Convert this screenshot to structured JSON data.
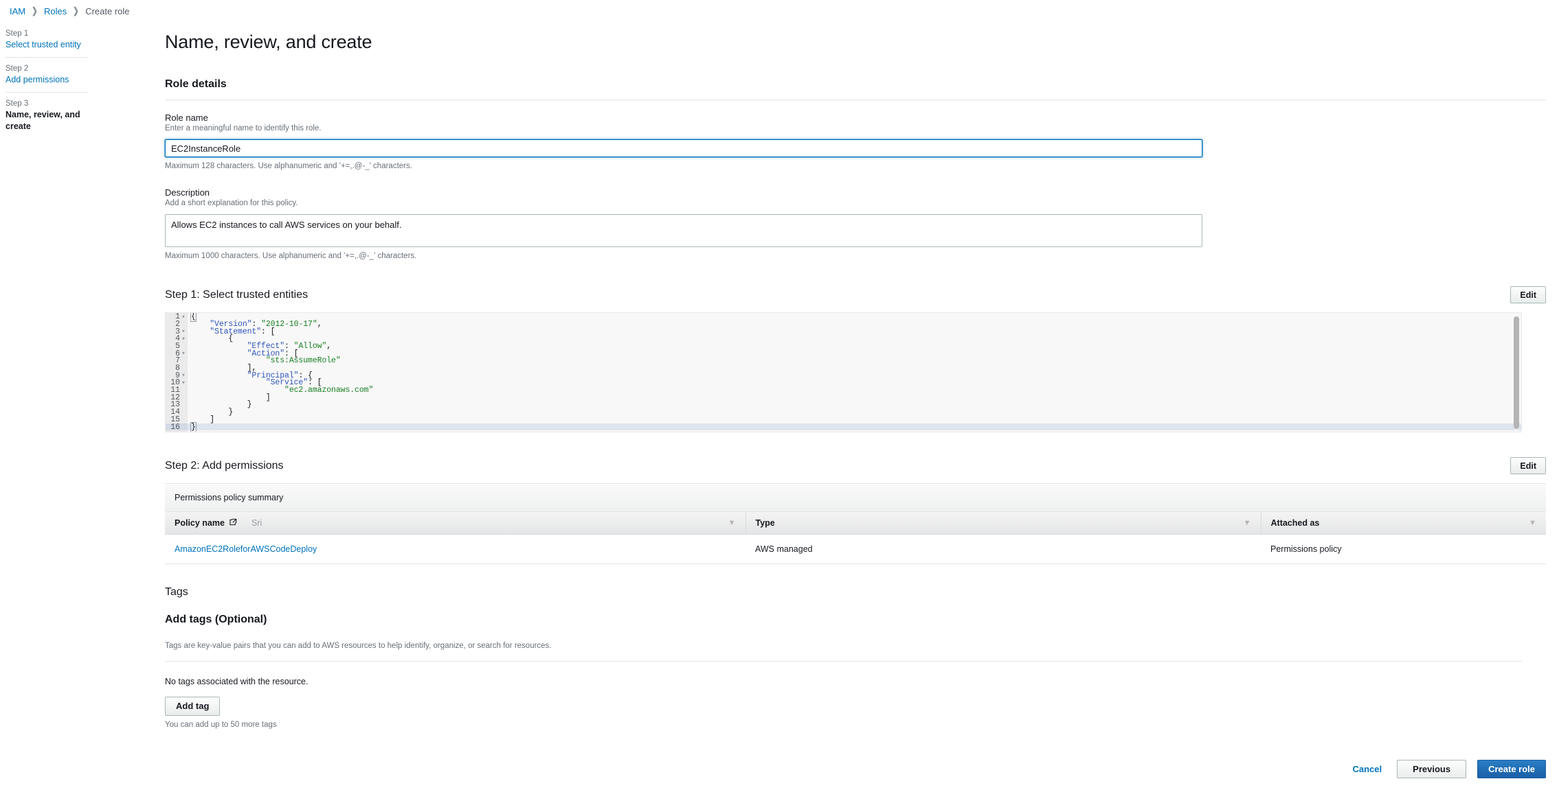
{
  "breadcrumb": {
    "items": [
      {
        "label": "IAM",
        "type": "link"
      },
      {
        "label": "Roles",
        "type": "link"
      },
      {
        "label": "Create role",
        "type": "current"
      }
    ],
    "separator": "❯"
  },
  "stepnav": {
    "steps": [
      {
        "number": "Step 1",
        "label": "Select trusted entity",
        "current": false
      },
      {
        "number": "Step 2",
        "label": "Add permissions",
        "current": false
      },
      {
        "number": "Step 3",
        "label": "Name, review, and create",
        "current": true
      }
    ]
  },
  "page": {
    "title": "Name, review, and create"
  },
  "role_details": {
    "heading": "Role details",
    "role_name": {
      "label": "Role name",
      "description": "Enter a meaningful name to identify this role.",
      "value": "EC2InstanceRole",
      "placeholder": "",
      "hint": "Maximum 128 characters. Use alphanumeric and '+=,.@-_' characters."
    },
    "description_field": {
      "label": "Description",
      "description": "Add a short explanation for this policy.",
      "value": "Allows EC2 instances to call AWS services on your behalf.",
      "placeholder": "",
      "hint": "Maximum 1000 characters. Use alphanumeric and '+=,.@-_' characters."
    }
  },
  "step1": {
    "heading": "Step 1: Select trusted entities",
    "edit_label": "Edit",
    "policy_lines": [
      {
        "n": "1",
        "fold": true,
        "active": false,
        "tokens": [
          {
            "t": "{",
            "c": "p"
          }
        ]
      },
      {
        "n": "2",
        "fold": false,
        "active": false,
        "tokens": [
          {
            "t": "    ",
            "c": "p"
          },
          {
            "t": "\"Version\"",
            "c": "k"
          },
          {
            "t": ": ",
            "c": "p"
          },
          {
            "t": "\"2012-10-17\"",
            "c": "s"
          },
          {
            "t": ",",
            "c": "p"
          }
        ]
      },
      {
        "n": "3",
        "fold": true,
        "active": false,
        "tokens": [
          {
            "t": "    ",
            "c": "p"
          },
          {
            "t": "\"Statement\"",
            "c": "k"
          },
          {
            "t": ": [",
            "c": "p"
          }
        ]
      },
      {
        "n": "4",
        "fold": true,
        "active": false,
        "tokens": [
          {
            "t": "        {",
            "c": "p"
          }
        ]
      },
      {
        "n": "5",
        "fold": false,
        "active": false,
        "tokens": [
          {
            "t": "            ",
            "c": "p"
          },
          {
            "t": "\"Effect\"",
            "c": "k"
          },
          {
            "t": ": ",
            "c": "p"
          },
          {
            "t": "\"Allow\"",
            "c": "s"
          },
          {
            "t": ",",
            "c": "p"
          }
        ]
      },
      {
        "n": "6",
        "fold": true,
        "active": false,
        "tokens": [
          {
            "t": "            ",
            "c": "p"
          },
          {
            "t": "\"Action\"",
            "c": "k"
          },
          {
            "t": ": [",
            "c": "p"
          }
        ]
      },
      {
        "n": "7",
        "fold": false,
        "active": false,
        "tokens": [
          {
            "t": "                ",
            "c": "p"
          },
          {
            "t": "\"sts:AssumeRole\"",
            "c": "s"
          }
        ]
      },
      {
        "n": "8",
        "fold": false,
        "active": false,
        "tokens": [
          {
            "t": "            ],",
            "c": "p"
          }
        ]
      },
      {
        "n": "9",
        "fold": true,
        "active": false,
        "tokens": [
          {
            "t": "            ",
            "c": "p"
          },
          {
            "t": "\"Principal\"",
            "c": "k"
          },
          {
            "t": ": {",
            "c": "p"
          }
        ]
      },
      {
        "n": "10",
        "fold": true,
        "active": false,
        "tokens": [
          {
            "t": "                ",
            "c": "p"
          },
          {
            "t": "\"Service\"",
            "c": "k"
          },
          {
            "t": ": [",
            "c": "p"
          }
        ]
      },
      {
        "n": "11",
        "fold": false,
        "active": false,
        "tokens": [
          {
            "t": "                    ",
            "c": "p"
          },
          {
            "t": "\"ec2.amazonaws.com\"",
            "c": "s"
          }
        ]
      },
      {
        "n": "12",
        "fold": false,
        "active": false,
        "tokens": [
          {
            "t": "                ]",
            "c": "p"
          }
        ]
      },
      {
        "n": "13",
        "fold": false,
        "active": false,
        "tokens": [
          {
            "t": "            }",
            "c": "p"
          }
        ]
      },
      {
        "n": "14",
        "fold": false,
        "active": false,
        "tokens": [
          {
            "t": "        }",
            "c": "p"
          }
        ]
      },
      {
        "n": "15",
        "fold": false,
        "active": false,
        "tokens": [
          {
            "t": "    ]",
            "c": "p"
          }
        ]
      },
      {
        "n": "16",
        "fold": false,
        "active": true,
        "tokens": [
          {
            "t": "}",
            "c": "p"
          }
        ]
      }
    ]
  },
  "step2": {
    "heading": "Step 2: Add permissions",
    "edit_label": "Edit",
    "table_caption": "Permissions policy summary",
    "columns": [
      {
        "label": "Policy name",
        "icon": "external-link-icon",
        "filter_text": "Sri",
        "sortable": true
      },
      {
        "label": "Type",
        "icon": "",
        "filter_text": "",
        "sortable": true
      },
      {
        "label": "Attached as",
        "icon": "",
        "filter_text": "",
        "sortable": true
      }
    ],
    "rows": [
      {
        "policy_name": "AmazonEC2RoleforAWSCodeDeploy",
        "type": "AWS managed",
        "attached_as": "Permissions policy"
      }
    ]
  },
  "tags": {
    "heading": "Tags",
    "subheading": "Add tags (Optional)",
    "description": "Tags are key-value pairs that you can add to AWS resources to help identify, organize, or search for resources.",
    "empty_text": "No tags associated with the resource.",
    "add_button": "Add tag",
    "limit_text": "You can add up to 50 more tags"
  },
  "footer": {
    "cancel": "Cancel",
    "previous": "Previous",
    "create": "Create role"
  },
  "colors": {
    "link": "#0073bb",
    "primary_button": "#1a5fa8",
    "focus_border": "#0073bb",
    "json_key": "#2e54bb",
    "json_string": "#187f22"
  }
}
